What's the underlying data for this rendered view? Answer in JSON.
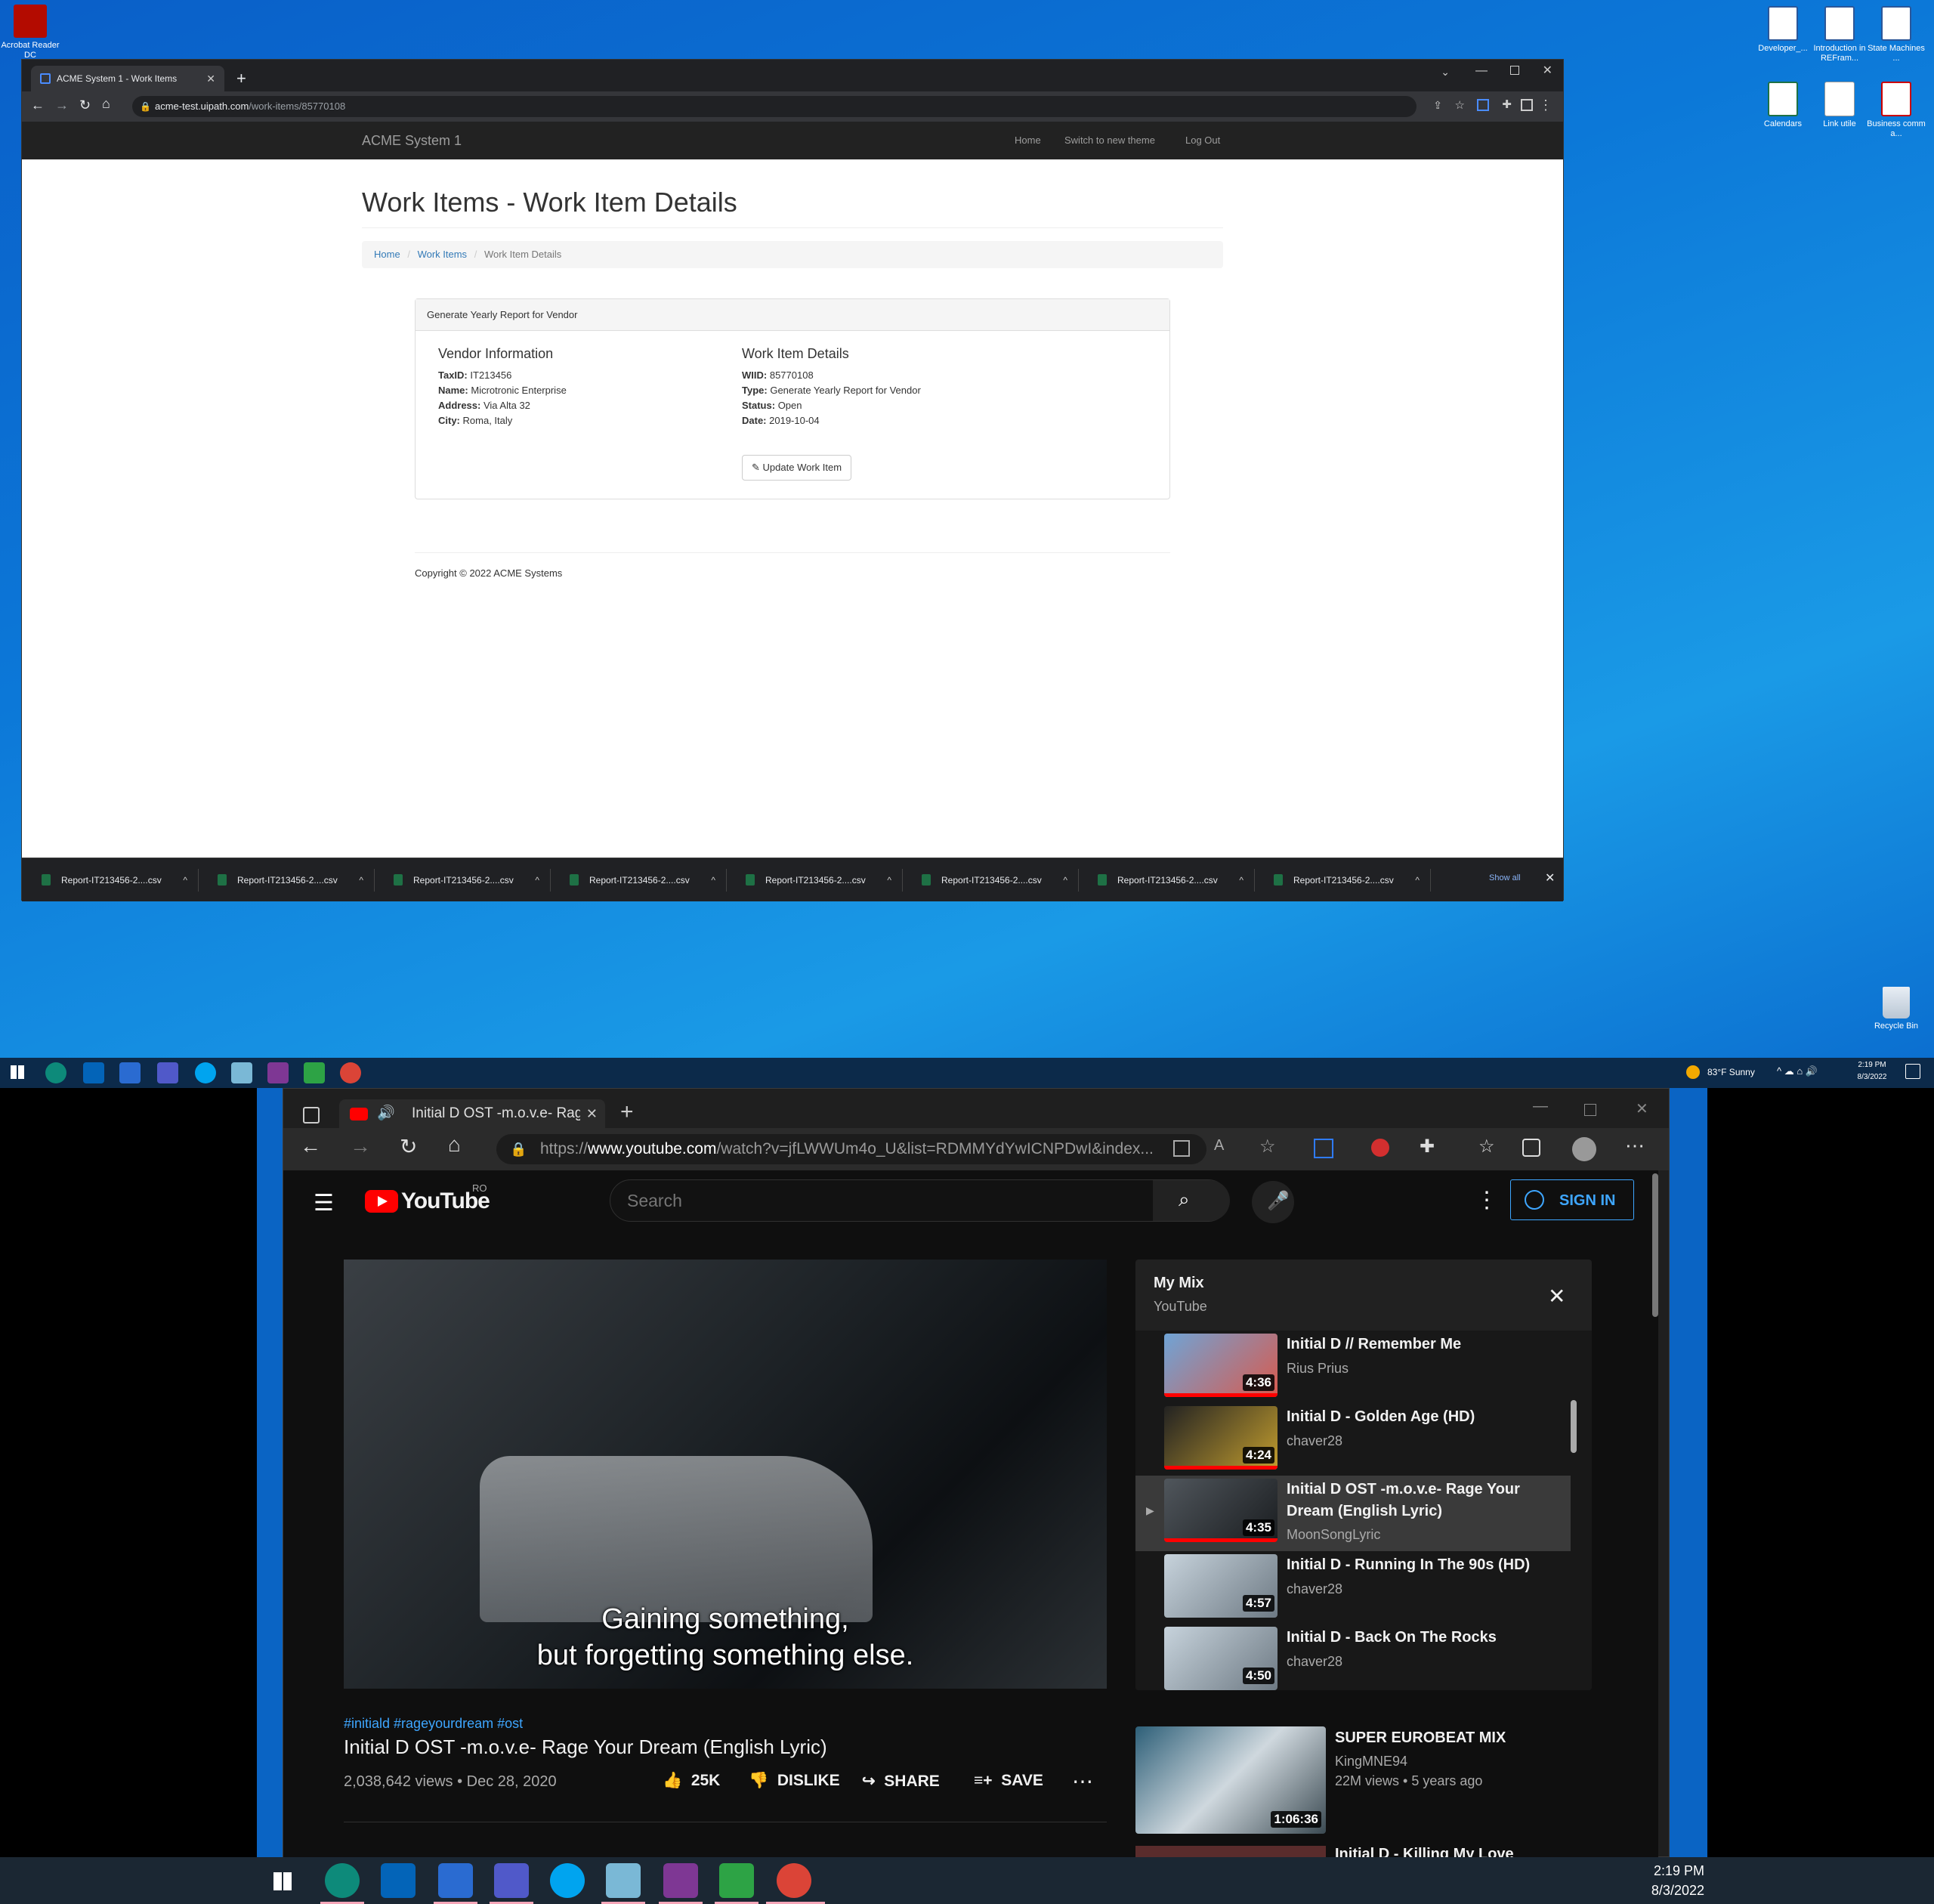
{
  "desktop": {
    "left_icons": [
      {
        "label": "Acrobat Reader DC"
      }
    ],
    "right_icons": [
      {
        "label": "Developer_..."
      },
      {
        "label": "Introduction in REFram..."
      },
      {
        "label": "State Machines ..."
      },
      {
        "label": "Calendars"
      },
      {
        "label": "Link utile"
      },
      {
        "label": "Business comm a..."
      }
    ],
    "recycle_bin": "Recycle Bin"
  },
  "browser1": {
    "tab_title": "ACME System 1 - Work Items",
    "url_host": "acme-test.uipath.com",
    "url_path": "/work-items/85770108"
  },
  "acme": {
    "brand": "ACME System 1",
    "nav": {
      "home": "Home",
      "theme": "Switch to new theme",
      "logout": "Log Out"
    },
    "page_title": "Work Items - Work Item Details",
    "breadcrumb": {
      "home": "Home",
      "work_items": "Work Items",
      "current": "Work Item Details"
    },
    "panel_heading": "Generate Yearly Report for Vendor",
    "vendor": {
      "heading": "Vendor Information",
      "taxid_label": "TaxID:",
      "taxid": "IT213456",
      "name_label": "Name:",
      "name": "Microtronic Enterprise",
      "address_label": "Address:",
      "address": "Via Alta 32",
      "city_label": "City:",
      "city": "Roma, Italy"
    },
    "details": {
      "heading": "Work Item Details",
      "wiid_label": "WIID:",
      "wiid": "85770108",
      "type_label": "Type:",
      "type": "Generate Yearly Report for Vendor",
      "status_label": "Status:",
      "status": "Open",
      "date_label": "Date:",
      "date": "2019-10-04"
    },
    "update_button": "Update Work Item",
    "footer": "Copyright © 2022 ACME Systems"
  },
  "downloads": {
    "items": [
      "Report-IT213456-2....csv",
      "Report-IT213456-2....csv",
      "Report-IT213456-2....csv",
      "Report-IT213456-2....csv",
      "Report-IT213456-2....csv",
      "Report-IT213456-2....csv",
      "Report-IT213456-2....csv",
      "Report-IT213456-2....csv"
    ],
    "show_all": "Show all"
  },
  "taskbar1": {
    "weather": "83°F Sunny",
    "time": "2:19 PM",
    "date": "8/3/2022"
  },
  "browser2": {
    "tab_title": "Initial D OST -m.o.v.e- Rage",
    "url_prefix": "https://",
    "url_host": "www.youtube.com",
    "url_path": "/watch?v=jfLWWUm4o_U&list=RDMMYdYwICNPDwI&index..."
  },
  "youtube": {
    "logo_text": "YouTube",
    "region": "RO",
    "search_placeholder": "Search",
    "sign_in": "SIGN IN",
    "video": {
      "subtitle_line1": "Gaining something,",
      "subtitle_line2": "but forgetting something else.",
      "hashtags": "#initiald #rageyourdream #ost",
      "title": "Initial D OST -m.o.v.e- Rage Your Dream (English Lyric)",
      "stats": "2,038,642 views • Dec 28, 2020",
      "likes": "25K",
      "dislike": "DISLIKE",
      "share": "SHARE",
      "save": "SAVE"
    },
    "playlist": {
      "title": "My Mix",
      "subtitle": "YouTube",
      "items": [
        {
          "title": "Initial D // Remember Me",
          "channel": "Rius Prius",
          "duration": "4:36"
        },
        {
          "title": "Initial D - Golden Age (HD)",
          "channel": "chaver28",
          "duration": "4:24"
        },
        {
          "title": "Initial D OST -m.o.v.e- Rage Your Dream (English Lyric)",
          "channel": "MoonSongLyric",
          "duration": "4:35"
        },
        {
          "title": "Initial D - Running In The 90s (HD)",
          "channel": "chaver28",
          "duration": "4:57"
        },
        {
          "title": "Initial D - Back On The Rocks",
          "channel": "chaver28",
          "duration": "4:50"
        }
      ]
    },
    "recommended": {
      "title": "SUPER EUROBEAT MIX",
      "channel": "KingMNE94",
      "meta": "22M views • 5 years ago",
      "duration": "1:06:36",
      "next_title": "Initial D - Killing My Love"
    }
  },
  "taskbar2": {
    "time": "2:19 PM",
    "date": "8/3/2022"
  }
}
